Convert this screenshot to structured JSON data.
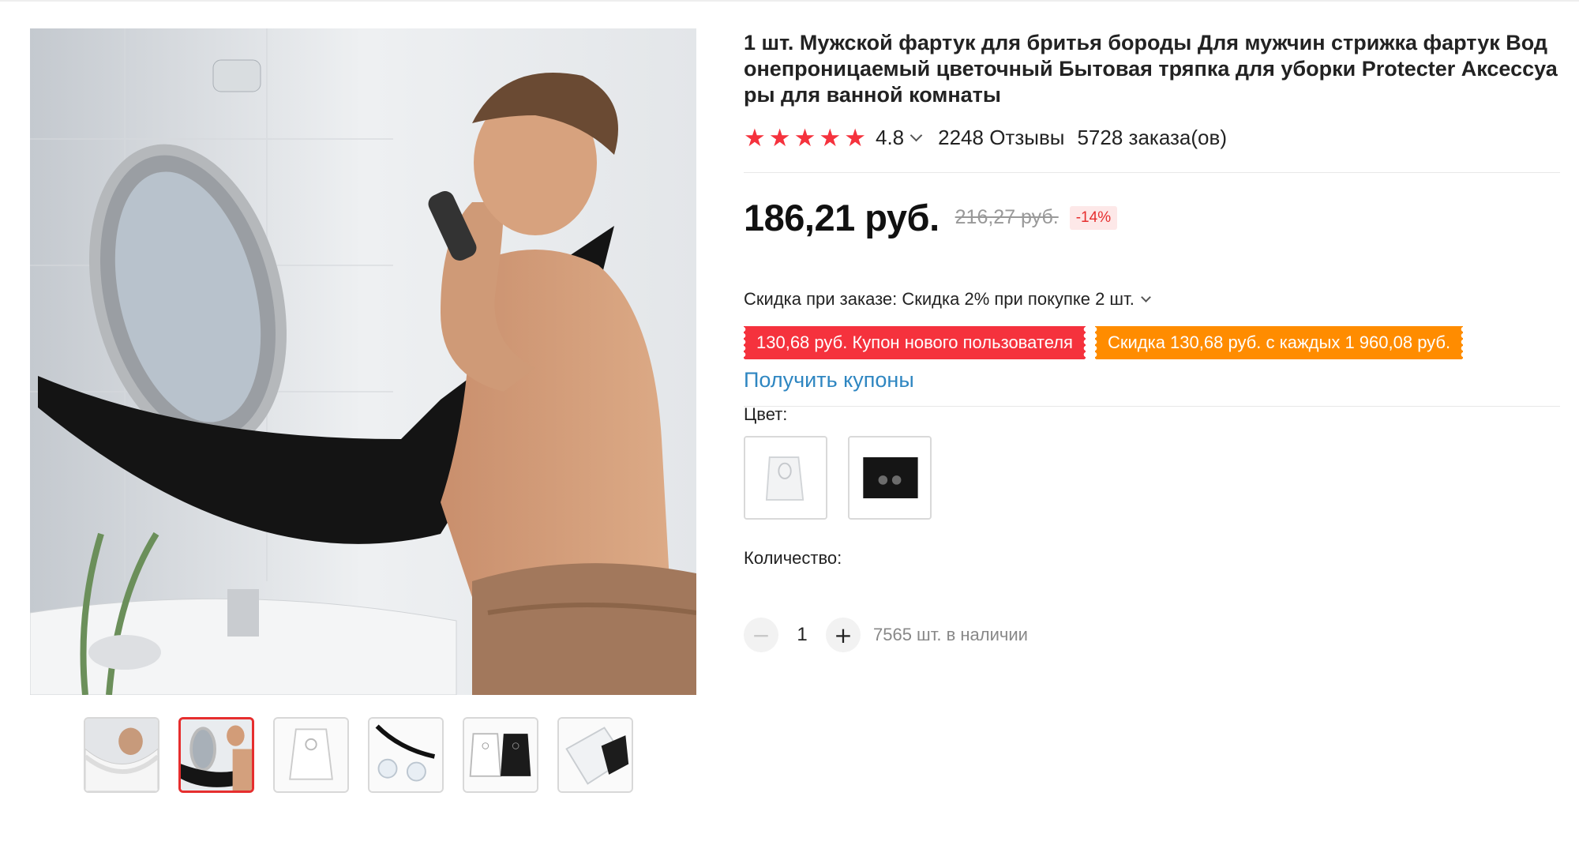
{
  "product": {
    "title": "1 шт. Мужской фартук для бритья бороды Для мужчин стрижка фартук Водонепроницаемый цветочный Бытовая тряпка для уборки Protecter Аксессуары для ванной комнаты",
    "rating": "4.8",
    "stars": 5,
    "reviews": "2248 Отзывы",
    "orders": "5728 заказа(ов)"
  },
  "price": {
    "current": "186,21 руб.",
    "old": "216,27 руб.",
    "discount": "-14%"
  },
  "bulk_discount": "Скидка при заказе: Скидка 2% при покупке 2 шт.",
  "coupons": [
    {
      "label": "130,68 руб. Купон нового пользователя",
      "color": "#f5323d"
    },
    {
      "label": "Скидка 130,68 руб. с каждых 1 960,08 руб.",
      "color": "#ff8c00"
    }
  ],
  "get_coupons_label": "Получить купоны",
  "color_label": "Цвет:",
  "colors": [
    {
      "name": "white-apron",
      "icon": "white-apron-swatch"
    },
    {
      "name": "black-apron",
      "icon": "black-apron-swatch"
    }
  ],
  "quantity": {
    "label": "Количество:",
    "value": "1",
    "minus": "−",
    "plus": "+",
    "stock": "7565 шт. в наличии"
  },
  "gallery": {
    "thumbnail_count": 6,
    "active_thumbnail": 2
  },
  "colors_palette": {
    "accent_red": "#f5323d",
    "accent_orange": "#ff8c00",
    "link_blue": "#2e86c1"
  }
}
